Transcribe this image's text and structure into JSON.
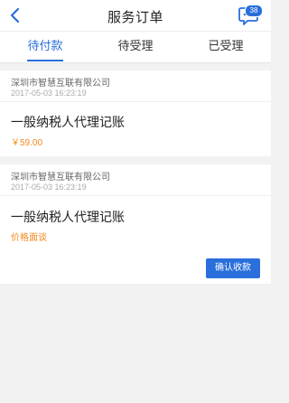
{
  "navbar": {
    "title": "服务订单",
    "back_icon": "chevron-left-icon",
    "message_icon": "message-icon",
    "message_badge": "38"
  },
  "tabs": [
    {
      "label": "待付款",
      "active": true
    },
    {
      "label": "待受理",
      "active": false
    },
    {
      "label": "已受理",
      "active": false
    }
  ],
  "orders": [
    {
      "company": "深圳市智慧互联有限公司",
      "timestamp": "2017-05-03 16:23:19",
      "service": "一般纳税人代理记账",
      "price": "￥59.00"
    },
    {
      "company": "深圳市智慧互联有限公司",
      "timestamp": "2017-05-03 16:23:19",
      "service": "一般纳税人代理记账",
      "price": "价格面谈",
      "action_label": "确认收款"
    }
  ],
  "colors": {
    "accent": "#2a6fdb",
    "price": "#f08a1c",
    "background": "#f2f2f2"
  }
}
